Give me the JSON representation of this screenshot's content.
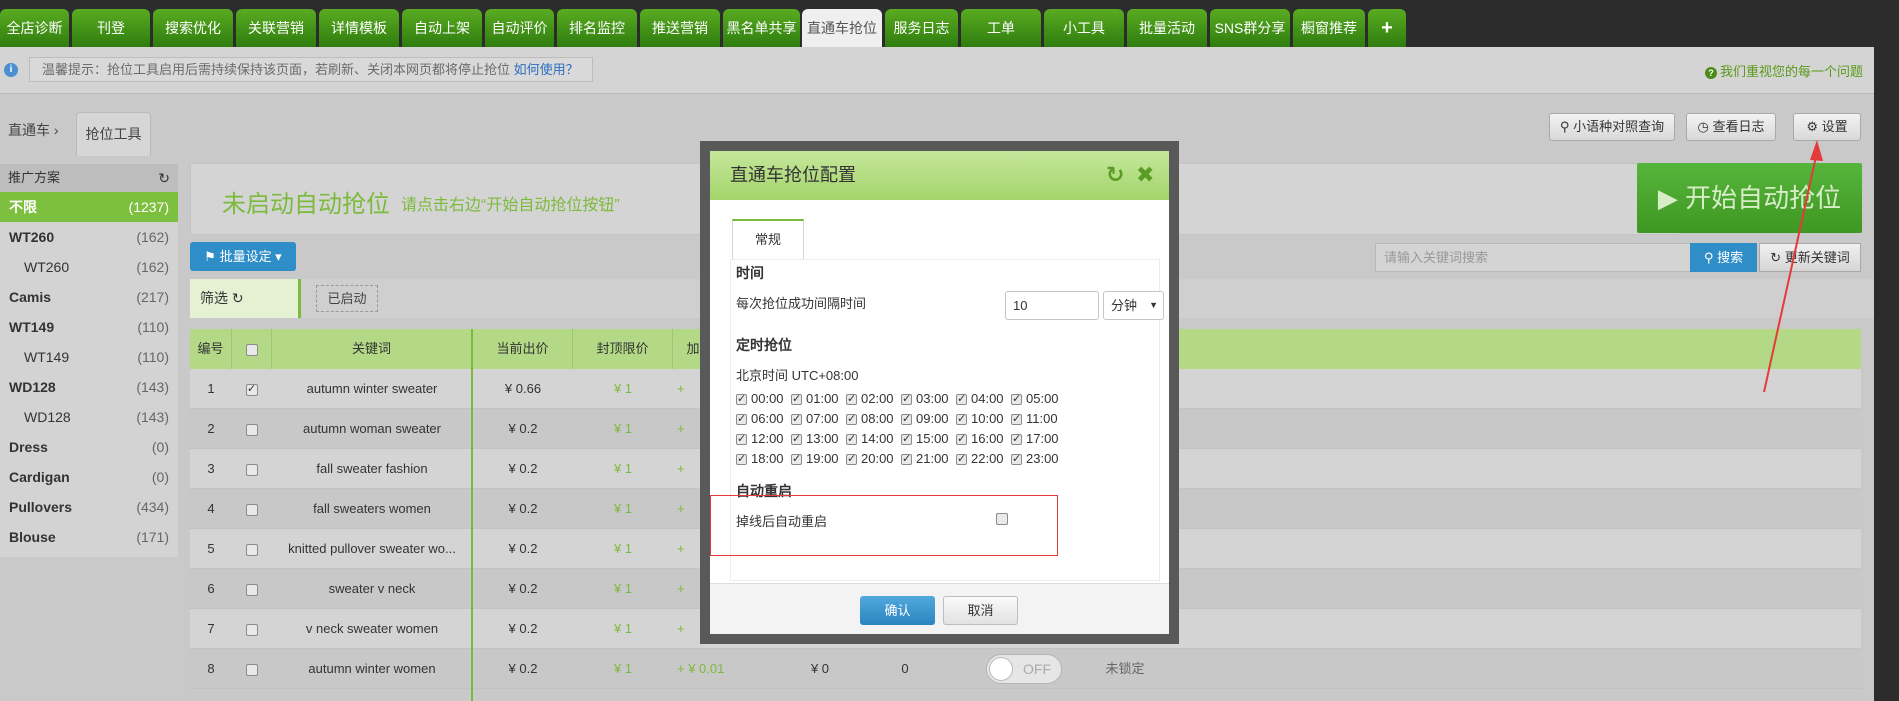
{
  "top_tabs": [
    "全店诊断",
    "刊登",
    "搜索优化",
    "关联营销",
    "详情模板",
    "自动上架",
    "自动评价",
    "排名监控",
    "推送营销",
    "黑名单共享",
    "直通车抢位",
    "服务日志",
    "工单",
    "小工具",
    "批量活动",
    "SNS群分享",
    "橱窗推荐",
    "+"
  ],
  "active_tab": "直通车抢位",
  "notice": {
    "text": "温馨提示：抢位工具启用后需持续保持该页面，若刷新、关闭本网页都将停止抢位 ",
    "link": "如何使用？",
    "right": "我们重视您的每一个问题"
  },
  "breadcrumb": {
    "root": "直通车",
    "sep": "›",
    "current": "抢位工具"
  },
  "toolbar": {
    "compare": "小语种对照查询",
    "log": "查看日志",
    "settings": "设置"
  },
  "sidebar": {
    "title": "推广方案",
    "items": [
      {
        "label": "不限",
        "count": "(1237)"
      },
      {
        "label": "WT260",
        "count": "(162)"
      },
      {
        "label": "WT260",
        "count": "(162)"
      },
      {
        "label": "Camis",
        "count": "(217)"
      },
      {
        "label": "WT149",
        "count": "(110)"
      },
      {
        "label": "WT149",
        "count": "(110)"
      },
      {
        "label": "WD128",
        "count": "(143)"
      },
      {
        "label": "WD128",
        "count": "(143)"
      },
      {
        "label": "Dress",
        "count": "(0)"
      },
      {
        "label": "Cardigan",
        "count": "(0)"
      },
      {
        "label": "Pullovers",
        "count": "(434)"
      },
      {
        "label": "Blouse",
        "count": "(171)"
      }
    ]
  },
  "banner": {
    "status": "未启动自动抢位",
    "hint": "请点击右边“开始自动抢位按钮”",
    "start": "▶ 开始自动抢位"
  },
  "bulk_label": "批量设定 ▾",
  "search": {
    "placeholder": "请输入关键词搜索",
    "btn": "搜索",
    "refresh": "更新关键词"
  },
  "filter": {
    "label": "筛选",
    "started": "已启动"
  },
  "table": {
    "headers": [
      "编号",
      "",
      "关键词",
      "当前出价",
      "封顶限价",
      "加"
    ],
    "rows": [
      {
        "no": "1",
        "checked": true,
        "kw": "autumn winter sweater",
        "bid": "¥ 0.66",
        "cap": "¥ 1",
        "extra": "+"
      },
      {
        "no": "2",
        "checked": false,
        "kw": "autumn woman sweater",
        "bid": "¥ 0.2",
        "cap": "¥ 1",
        "extra": "+"
      },
      {
        "no": "3",
        "checked": false,
        "kw": "fall sweater fashion",
        "bid": "¥ 0.2",
        "cap": "¥ 1",
        "extra": "+"
      },
      {
        "no": "4",
        "checked": false,
        "kw": "fall sweaters women",
        "bid": "¥ 0.2",
        "cap": "¥ 1",
        "extra": "+"
      },
      {
        "no": "5",
        "checked": false,
        "kw": "knitted pullover sweater wo...",
        "bid": "¥ 0.2",
        "cap": "¥ 1",
        "extra": "+"
      },
      {
        "no": "6",
        "checked": false,
        "kw": "sweater v neck",
        "bid": "¥ 0.2",
        "cap": "¥ 1",
        "extra": "+"
      },
      {
        "no": "7",
        "checked": false,
        "kw": "v neck sweater women",
        "bid": "¥ 0.2",
        "cap": "¥ 1",
        "extra": "+"
      },
      {
        "no": "8",
        "checked": false,
        "kw": "autumn winter women",
        "bid": "¥ 0.2",
        "cap": "¥ 1",
        "extra": "+ ¥ 0.01",
        "col6": "¥ 0",
        "col7": "0",
        "toggle": "OFF",
        "lock": "未锁定"
      }
    ]
  },
  "modal": {
    "title": "直通车抢位配置",
    "tab": "常规",
    "sec_time": "时间",
    "interval_label": "每次抢位成功间隔时间",
    "interval_value": "10",
    "interval_unit": "分钟",
    "sec_schedule": "定时抢位",
    "tz": "北京时间 UTC+08:00",
    "hours": [
      "00:00",
      "01:00",
      "02:00",
      "03:00",
      "04:00",
      "05:00",
      "06:00",
      "07:00",
      "08:00",
      "09:00",
      "10:00",
      "11:00",
      "12:00",
      "13:00",
      "14:00",
      "15:00",
      "16:00",
      "17:00",
      "18:00",
      "19:00",
      "20:00",
      "21:00",
      "22:00",
      "23:00"
    ],
    "sec_restart": "自动重启",
    "restart_label": "掉线后自动重启",
    "ok": "确认",
    "cancel": "取消"
  },
  "colors": {
    "green": "#7cba3c",
    "blue": "#2f8dc7",
    "highlight": "#e53a3a"
  }
}
